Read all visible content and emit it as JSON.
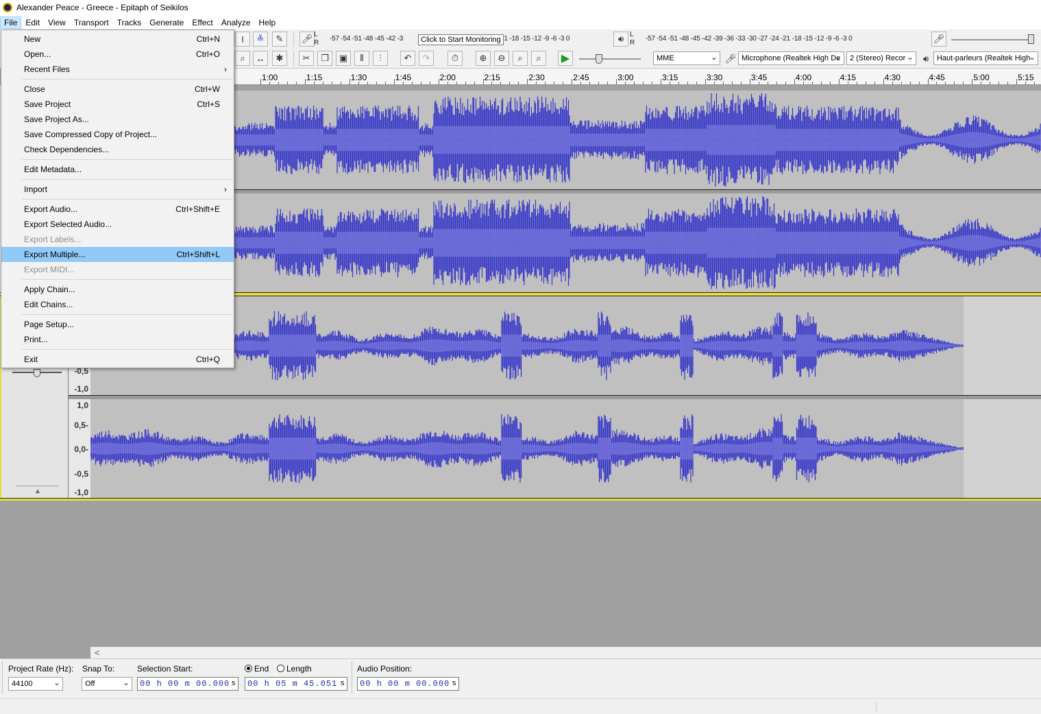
{
  "window": {
    "title": "Alexander Peace - Greece - Epitaph of Seikilos"
  },
  "menubar": [
    "File",
    "Edit",
    "View",
    "Transport",
    "Tracks",
    "Generate",
    "Effect",
    "Analyze",
    "Help"
  ],
  "file_menu": [
    {
      "label": "New",
      "shortcut": "Ctrl+N"
    },
    {
      "label": "Open...",
      "shortcut": "Ctrl+O"
    },
    {
      "label": "Recent Files",
      "submenu": true
    },
    {
      "sep": true
    },
    {
      "label": "Close",
      "shortcut": "Ctrl+W"
    },
    {
      "label": "Save Project",
      "shortcut": "Ctrl+S"
    },
    {
      "label": "Save Project As..."
    },
    {
      "label": "Save Compressed Copy of Project..."
    },
    {
      "label": "Check Dependencies..."
    },
    {
      "sep": true
    },
    {
      "label": "Edit Metadata..."
    },
    {
      "sep": true
    },
    {
      "label": "Import",
      "submenu": true
    },
    {
      "sep": true
    },
    {
      "label": "Export Audio...",
      "shortcut": "Ctrl+Shift+E"
    },
    {
      "label": "Export Selected Audio..."
    },
    {
      "label": "Export Labels...",
      "disabled": true
    },
    {
      "label": "Export Multiple...",
      "shortcut": "Ctrl+Shift+L",
      "highlighted": true
    },
    {
      "label": "Export MIDI...",
      "disabled": true
    },
    {
      "sep": true
    },
    {
      "label": "Apply Chain..."
    },
    {
      "label": "Edit Chains..."
    },
    {
      "sep": true
    },
    {
      "label": "Page Setup..."
    },
    {
      "label": "Print..."
    },
    {
      "sep": true
    },
    {
      "label": "Exit",
      "shortcut": "Ctrl+Q"
    }
  ],
  "toolbar": {
    "tooltip": "Click to Start Monitoring",
    "record_meter_scale": "-57 -54 -51 -48 -45 -42 -3",
    "record_meter_scale_tail": "21 -18 -15 -12 -9 -6 -3 0",
    "playback_meter_scale": "-57 -54 -51 -48 -45 -42 -39 -36 -33 -30 -27 -24 -21 -18 -15 -12 -9 -6 -3 0",
    "meter_l": "L",
    "meter_r": "R",
    "host": "MME",
    "input_device": "Microphone (Realtek High De",
    "channels": "2 (Stereo) Recor",
    "output_device": "Haut-parleurs (Realtek High"
  },
  "ruler_ticks": [
    "1:00",
    "1:15",
    "1:30",
    "1:45",
    "2:00",
    "2:15",
    "2:30",
    "2:45",
    "3:00",
    "3:15",
    "3:30",
    "3:45",
    "4:00",
    "4:15",
    "4:30",
    "4:45",
    "5:00",
    "5:15"
  ],
  "track2_vruler": {
    "upper_tail": [
      "-0,5",
      "-1,0"
    ],
    "lower": [
      "1,0",
      "0,5-",
      "0,0-",
      "-0,5",
      "-1,0"
    ]
  },
  "selection_bar": {
    "project_rate_label": "Project Rate (Hz):",
    "project_rate": "44100",
    "snap_to_label": "Snap To:",
    "snap_to": "Off",
    "selection_start_label": "Selection Start:",
    "selection_start": "00 h 00 m 00.000",
    "end_label": "End",
    "length_label": "Length",
    "end_value": "00 h 05 m 45.051",
    "audio_position_label": "Audio Position:",
    "audio_position": "00 h 00 m 00.000",
    "seconds_suffix": "s"
  },
  "colors": {
    "waveform": "#3232c8",
    "waveform_rms": "#6464dc",
    "wave_background": "#c0c0c0",
    "menu_highlight": "#91c9f7",
    "time_text": "#1c2fa8"
  }
}
